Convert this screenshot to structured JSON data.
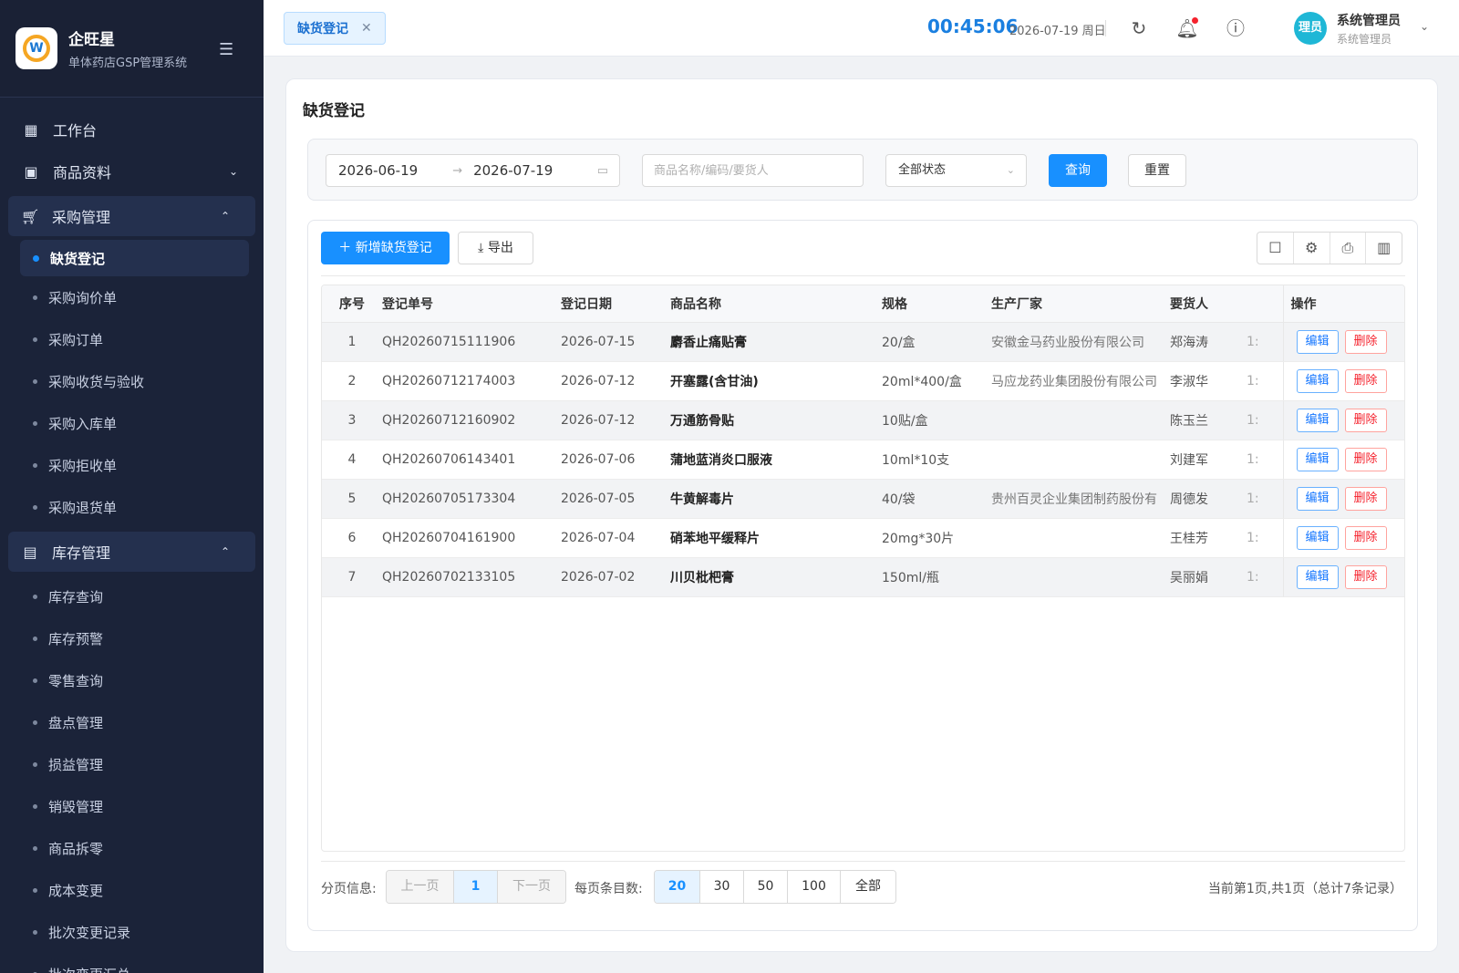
{
  "brand": {
    "name": "企旺星",
    "subtitle": "单体药店GSP管理系统",
    "logo_letter": "W"
  },
  "sidebar": {
    "items": [
      {
        "label": "工作台",
        "icon": "dashboard-icon"
      },
      {
        "label": "商品资料",
        "icon": "product-icon",
        "expanded": false
      }
    ],
    "groups": [
      {
        "label": "采购管理",
        "icon": "cart-icon",
        "expanded": true,
        "children": [
          "缺货登记",
          "采购询价单",
          "采购订单",
          "采购收货与验收",
          "采购入库单",
          "采购拒收单",
          "采购退货单"
        ],
        "active_child": "缺货登记"
      },
      {
        "label": "库存管理",
        "icon": "inventory-icon",
        "expanded": true,
        "children": [
          "库存查询",
          "库存预警",
          "零售查询",
          "盘点管理",
          "损益管理",
          "销毁管理",
          "商品拆零",
          "成本变更",
          "批次变更记录",
          "批次变更汇总"
        ]
      }
    ]
  },
  "header": {
    "tab_label": "缺货登记",
    "clock": "00:45:06",
    "date": "2026-07-19 周日",
    "user": {
      "avatar_text": "理员",
      "name": "系统管理员",
      "role": "系统管理员"
    }
  },
  "page": {
    "title": "缺货登记",
    "filters": {
      "date_start": "2026-06-19",
      "date_end": "2026-07-19",
      "search_placeholder": "商品名称/编码/要货人",
      "status": "全部状态",
      "query_label": "查询",
      "reset_label": "重置"
    },
    "toolbar": {
      "add_label": "新增缺货登记",
      "export_label": "导出"
    },
    "columns": [
      "序号",
      "登记单号",
      "登记日期",
      "商品名称",
      "规格",
      "生产厂家",
      "要货人",
      "操作"
    ],
    "rows": [
      {
        "no": "1",
        "code": "QH20260715111906",
        "date": "2026-07-15",
        "name": "麝香止痛贴膏",
        "spec": "20/盒",
        "mfr": "安徽金马药业股份有限公司",
        "requester": "郑海涛",
        "extra": "1:"
      },
      {
        "no": "2",
        "code": "QH20260712174003",
        "date": "2026-07-12",
        "name": "开塞露(含甘油)",
        "spec": "20ml*400/盒",
        "mfr": "马应龙药业集团股份有限公司",
        "requester": "李淑华",
        "extra": "1:"
      },
      {
        "no": "3",
        "code": "QH20260712160902",
        "date": "2026-07-12",
        "name": "万通筋骨贴",
        "spec": "10贴/盒",
        "mfr": "",
        "requester": "陈玉兰",
        "extra": "1:"
      },
      {
        "no": "4",
        "code": "QH20260706143401",
        "date": "2026-07-06",
        "name": "蒲地蓝消炎口服液",
        "spec": "10ml*10支",
        "mfr": "",
        "requester": "刘建军",
        "extra": "1:"
      },
      {
        "no": "5",
        "code": "QH20260705173304",
        "date": "2026-07-05",
        "name": "牛黄解毒片",
        "spec": "40/袋",
        "mfr": "贵州百灵企业集团制药股份有限",
        "requester": "周德发",
        "extra": "1:"
      },
      {
        "no": "6",
        "code": "QH20260704161900",
        "date": "2026-07-04",
        "name": "硝苯地平缓释片",
        "spec": "20mg*30片",
        "mfr": "",
        "requester": "王桂芳",
        "extra": "1:"
      },
      {
        "no": "7",
        "code": "QH20260702133105",
        "date": "2026-07-02",
        "name": "川贝枇杷膏",
        "spec": "150ml/瓶",
        "mfr": "",
        "requester": "吴丽娟",
        "extra": "1:"
      }
    ],
    "row_actions": {
      "edit": "编辑",
      "delete": "删除"
    },
    "pagination": {
      "label": "分页信息:",
      "prev": "上一页",
      "current": "1",
      "next": "下一页",
      "size_label": "每页条目数:",
      "sizes": [
        "20",
        "30",
        "50",
        "100",
        "全部"
      ],
      "current_size": "20",
      "summary": "当前第1页,共1页（总计7条记录）"
    }
  },
  "colors": {
    "primary": "#1890ff",
    "sidebar_bg": "#1b2339",
    "danger": "#f5222d"
  }
}
